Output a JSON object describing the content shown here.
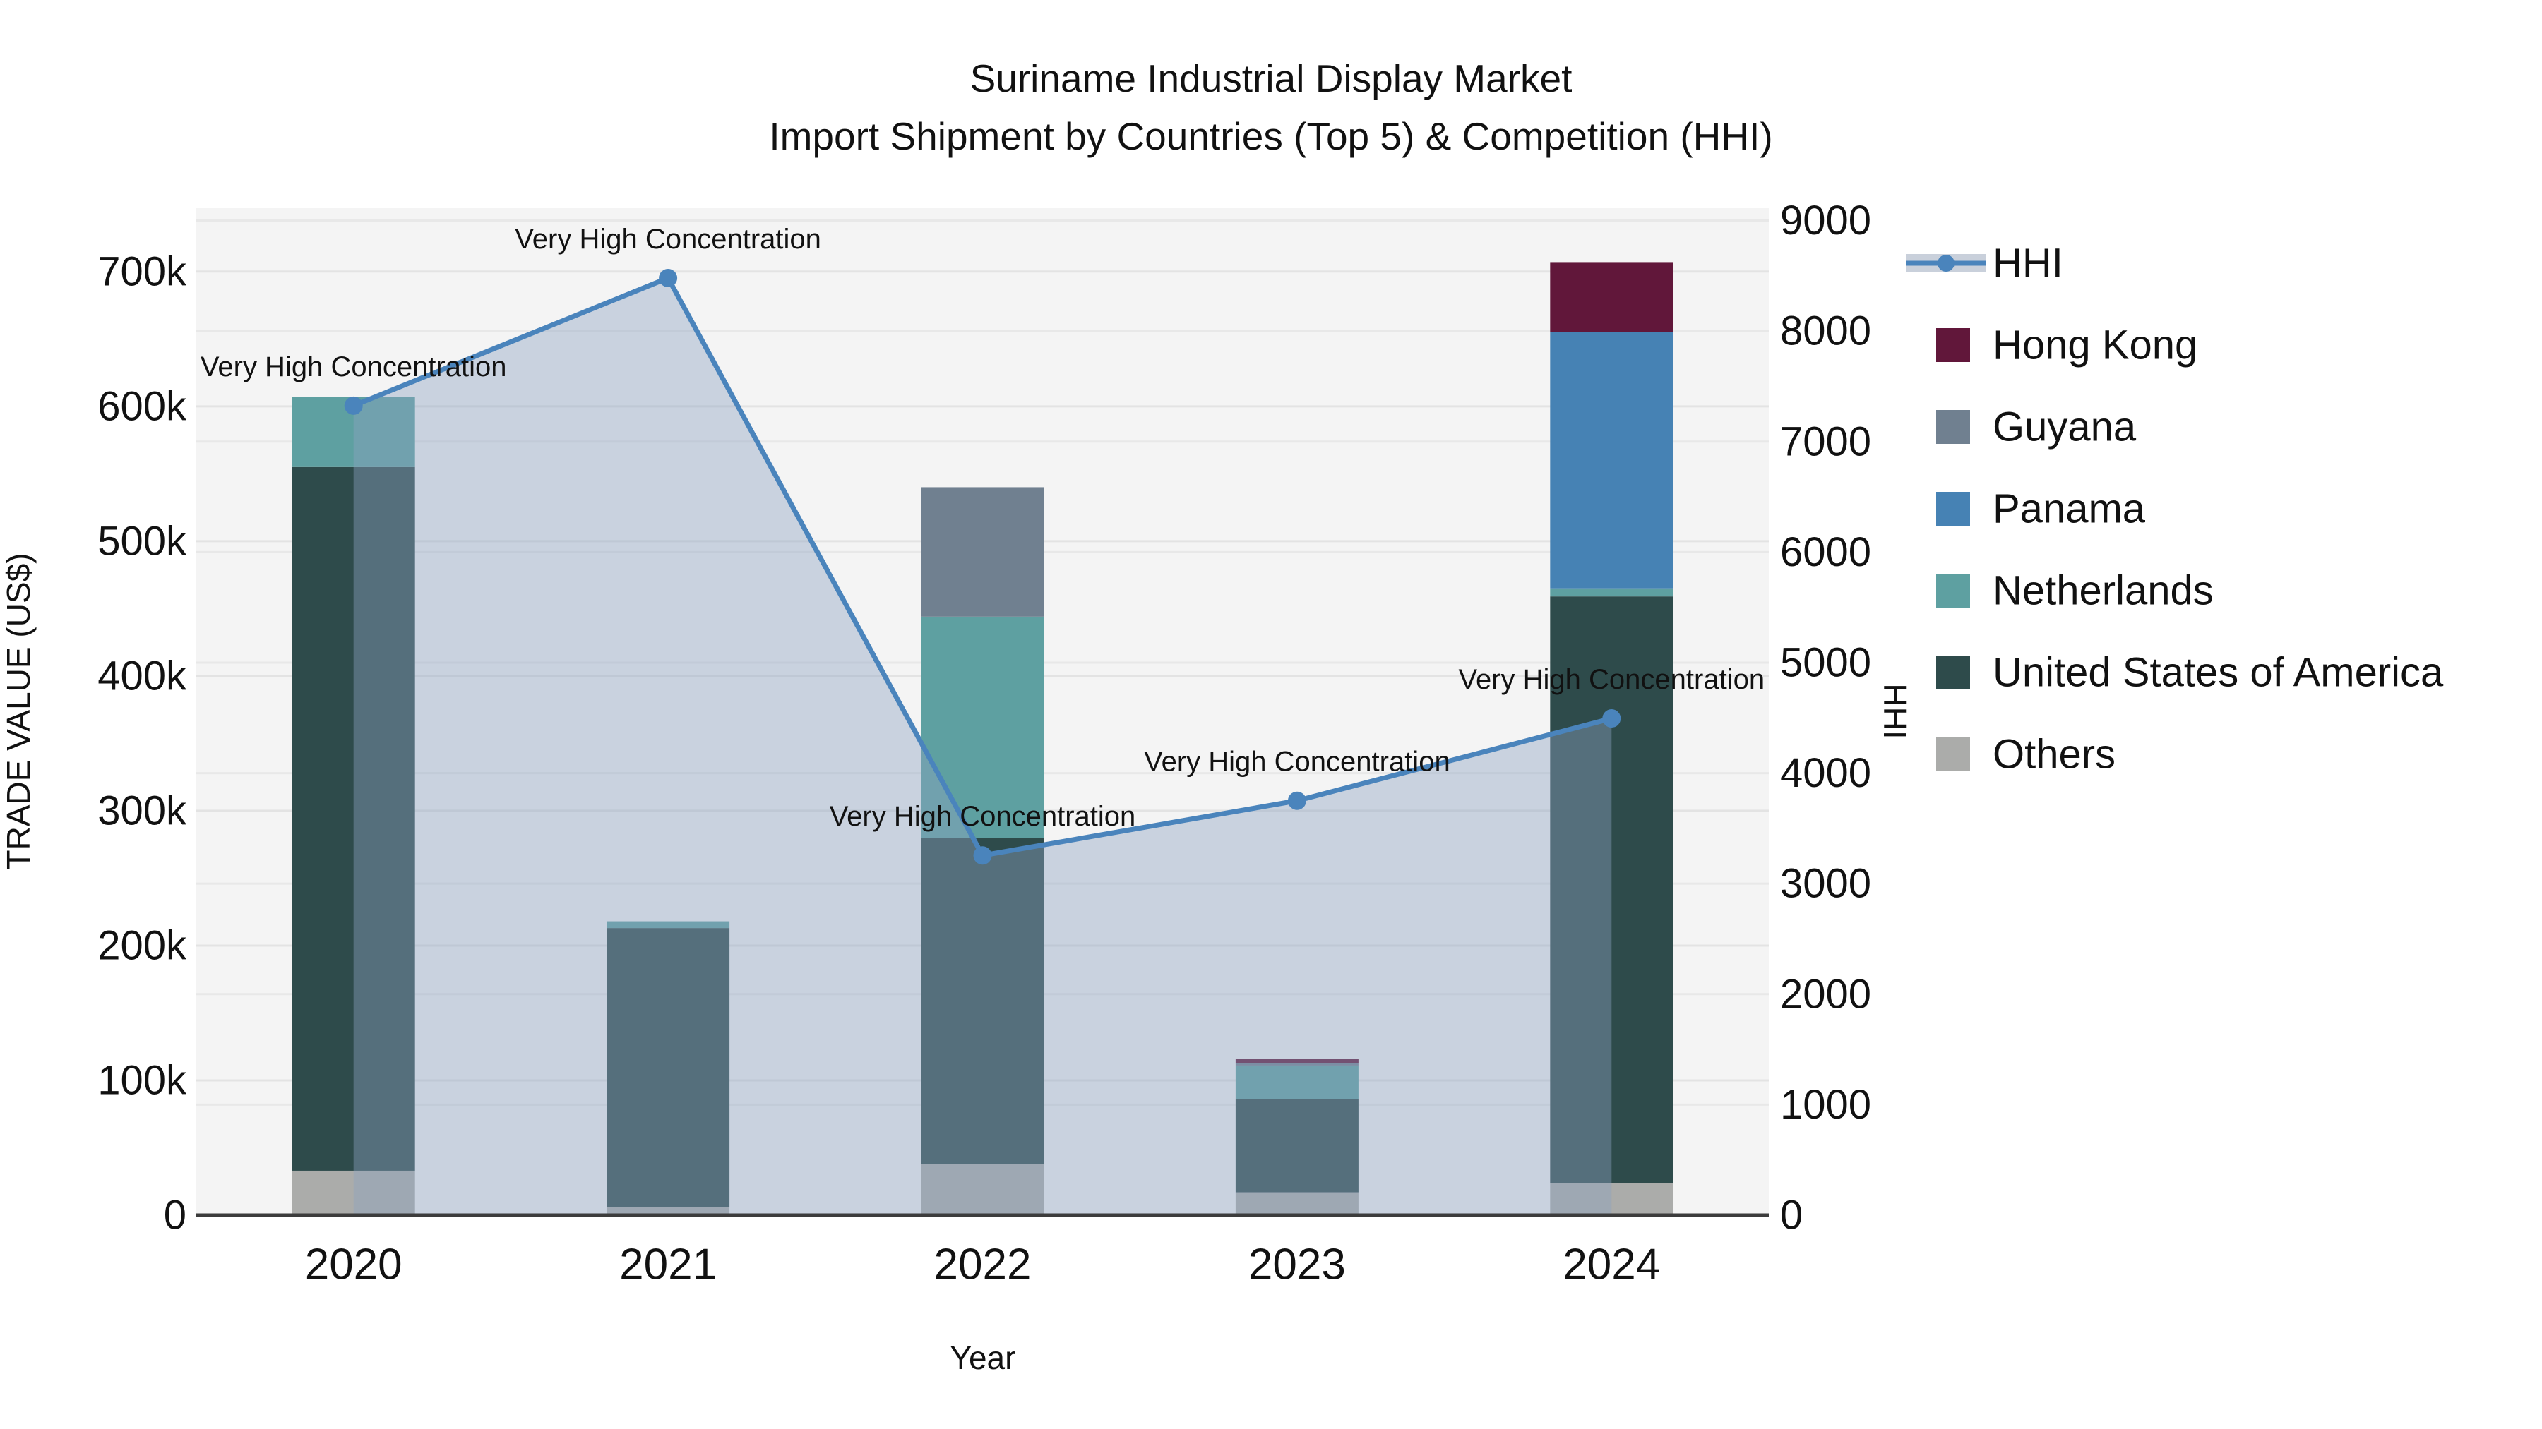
{
  "title": {
    "line1": "Suriname Industrial Display Market",
    "line2": "Import Shipment by Countries (Top 5) & Competition (HHI)"
  },
  "axes": {
    "x_title": "Year",
    "y_left_title": "TRADE VALUE (US$)",
    "y_right_title": "HHI",
    "x_labels": [
      "2020",
      "2021",
      "2022",
      "2023",
      "2024"
    ],
    "y_left_ticks": [
      {
        "label": "0",
        "value": 0
      },
      {
        "label": "100k",
        "value": 100000
      },
      {
        "label": "200k",
        "value": 200000
      },
      {
        "label": "300k",
        "value": 300000
      },
      {
        "label": "400k",
        "value": 400000
      },
      {
        "label": "500k",
        "value": 500000
      },
      {
        "label": "600k",
        "value": 600000
      },
      {
        "label": "700k",
        "value": 700000
      }
    ],
    "y_right_ticks": [
      {
        "label": "0",
        "value": 0
      },
      {
        "label": "1000",
        "value": 1000
      },
      {
        "label": "2000",
        "value": 2000
      },
      {
        "label": "3000",
        "value": 3000
      },
      {
        "label": "4000",
        "value": 4000
      },
      {
        "label": "5000",
        "value": 5000
      },
      {
        "label": "6000",
        "value": 6000
      },
      {
        "label": "7000",
        "value": 7000
      },
      {
        "label": "8000",
        "value": 8000
      },
      {
        "label": "9000",
        "value": 9000
      }
    ]
  },
  "legend": {
    "items": [
      {
        "label": "HHI",
        "type": "line",
        "color": "#4A84BC",
        "band": "#C9D0DB"
      },
      {
        "label": "Hong Kong",
        "type": "bar",
        "color": "#61173A"
      },
      {
        "label": "Guyana",
        "type": "bar",
        "color": "#708090"
      },
      {
        "label": "Panama",
        "type": "bar",
        "color": "#4682B4"
      },
      {
        "label": "Netherlands",
        "type": "bar",
        "color": "#5EA0A1"
      },
      {
        "label": "United States of America",
        "type": "bar",
        "color": "#2E4B4B"
      },
      {
        "label": "Others",
        "type": "bar",
        "color": "#ABACAA"
      }
    ]
  },
  "chart_data": {
    "type": "bar",
    "subtype": "stacked-bar-with-line",
    "title": "Suriname Industrial Display Market — Import Shipment by Countries (Top 5) & Competition (HHI)",
    "xlabel": "Year",
    "ylabel_left": "TRADE VALUE (US$)",
    "ylabel_right": "HHI",
    "categories": [
      "2020",
      "2021",
      "2022",
      "2023",
      "2024"
    ],
    "series": [
      {
        "name": "Others",
        "color": "#ABACAA",
        "axis": "left",
        "values": [
          33000,
          6000,
          38000,
          17000,
          24000
        ]
      },
      {
        "name": "United States of America",
        "color": "#2E4B4B",
        "axis": "left",
        "values": [
          522000,
          207000,
          242000,
          69000,
          435000
        ]
      },
      {
        "name": "Netherlands",
        "color": "#5EA0A1",
        "axis": "left",
        "values": [
          52000,
          5000,
          164000,
          25000,
          6000
        ]
      },
      {
        "name": "Panama",
        "color": "#4682B4",
        "axis": "left",
        "values": [
          0,
          0,
          0,
          0,
          190000
        ]
      },
      {
        "name": "Guyana",
        "color": "#708090",
        "axis": "left",
        "values": [
          0,
          0,
          96000,
          2000,
          0
        ]
      },
      {
        "name": "Hong Kong",
        "color": "#61173A",
        "axis": "left",
        "values": [
          0,
          0,
          0,
          3000,
          52000
        ]
      }
    ],
    "line_series": {
      "name": "HHI",
      "axis": "right",
      "color": "#4A84BC",
      "fill_color": "rgba(141,162,192,0.42)",
      "values": [
        7325,
        8480,
        3255,
        3750,
        4495
      ],
      "point_annotation": "Very High Concentration"
    },
    "ylim_left": [
      0,
      747000
    ],
    "ylim_right": [
      0,
      9112
    ],
    "grid": true,
    "legend_position": "right",
    "plot_background": "#F4F4F4",
    "grid_color": "#E3E3E3",
    "axis_line_color": "#3C3C3C"
  }
}
